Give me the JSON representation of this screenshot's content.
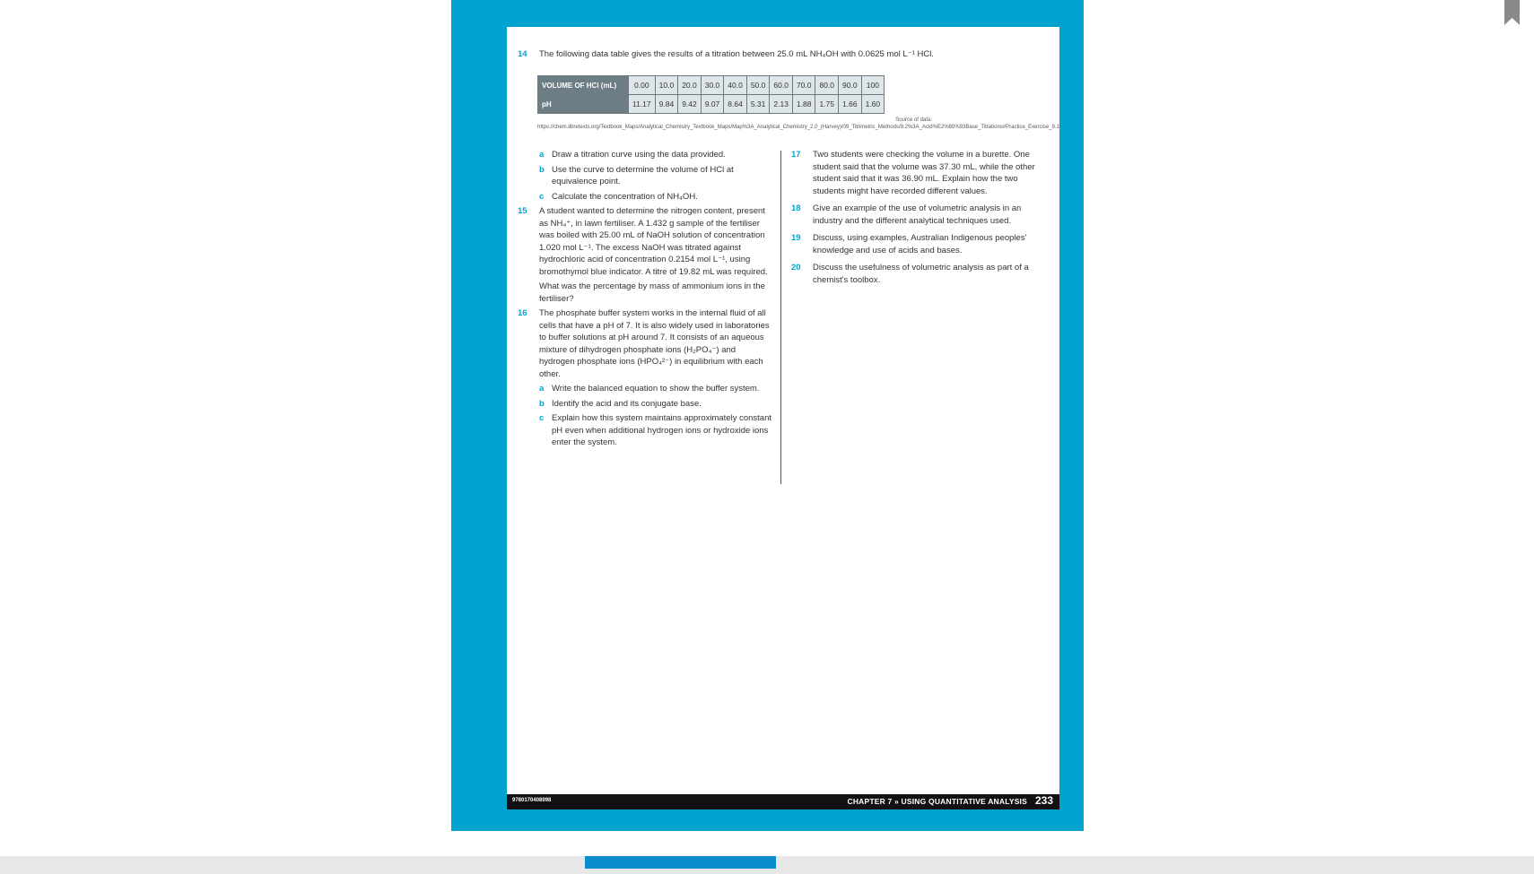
{
  "q14": {
    "number": "14",
    "text": "The following data table gives the results of a titration between 25.0 mL NH₄OH with 0.0625 mol L⁻¹ HCl.",
    "table": {
      "row1_label": "VOLUME OF HCl (mL)",
      "volumes": [
        "0.00",
        "10.0",
        "20.0",
        "30.0",
        "40.0",
        "50.0",
        "60.0",
        "70.0",
        "80.0",
        "90.0",
        "100"
      ],
      "row2_label": "pH",
      "ph": [
        "11.17",
        "9.84",
        "9.42",
        "9.07",
        "8.64",
        "5.31",
        "2.13",
        "1.88",
        "1.75",
        "1.66",
        "1.60"
      ]
    },
    "source": "Source of data: https://chem.libretexts.org/Textbook_Maps/Analytical_Chemistry_Textbook_Maps/Map%3A_Analytical_Chemistry_2.0_(Harvey)/09_Titrimetric_Methods/9.2%3A_Acid%E2%80%93Base_Titrations#Practice_Exercise_9.1",
    "parts": [
      {
        "letter": "a",
        "text": "Draw a titration curve using the data provided."
      },
      {
        "letter": "b",
        "text": "Use the curve to determine the volume of HCl at equivalence point."
      },
      {
        "letter": "c",
        "text": "Calculate the concentration of NH₄OH."
      }
    ]
  },
  "q15": {
    "number": "15",
    "text": "A student wanted to determine the nitrogen content, present as NH₄⁺, in lawn fertiliser. A 1.432 g sample of the fertiliser was boiled with 25.00 mL of NaOH solution of concentration 1.020 mol L⁻¹. The excess NaOH was titrated against hydrochloric acid of concentration 0.2154 mol L⁻¹, using bromothymol blue indicator. A titre of 19.82 mL was required.",
    "question": "What was the percentage by mass of ammonium ions in the fertiliser?"
  },
  "q16": {
    "number": "16",
    "text": "The phosphate buffer system works in the internal fluid of all cells that have a pH of 7. It is also widely used in laboratories to buffer solutions at pH around 7. It consists of an aqueous mixture of dihydrogen phosphate ions (H₂PO₄⁻) and hydrogen phosphate ions (HPO₄²⁻) in equilibrium with each other.",
    "parts": [
      {
        "letter": "a",
        "text": "Write the balanced equation to show the buffer system."
      },
      {
        "letter": "b",
        "text": "Identify the acid and its conjugate base."
      },
      {
        "letter": "c",
        "text": "Explain how this system maintains approximately constant pH even when additional hydrogen ions or hydroxide ions enter the system."
      }
    ]
  },
  "q17": {
    "number": "17",
    "text": "Two students were checking the volume in a burette. One student said that the volume was 37.30 mL, while the other student said that it was 36.90 mL. Explain how the two students might have recorded different values."
  },
  "q18": {
    "number": "18",
    "text": "Give an example of the use of volumetric analysis in an industry and the different analytical techniques used."
  },
  "q19": {
    "number": "19",
    "text": "Discuss, using examples, Australian Indigenous peoples' knowledge and use of acids and bases."
  },
  "q20": {
    "number": "20",
    "text": "Discuss the usefulness of volumetric analysis as part of a chemist's toolbox."
  },
  "footer": {
    "isbn": "9780170408998",
    "chapter": "CHAPTER 7 » USING QUANTITATIVE ANALYSIS",
    "page": "233"
  },
  "icons": {
    "bookmark": "bookmark-icon"
  },
  "colors": {
    "accent": "#00a3cf",
    "frame": "#00a3cf",
    "footer": "#111111",
    "scroll_thumb": "#0a8ccc"
  }
}
